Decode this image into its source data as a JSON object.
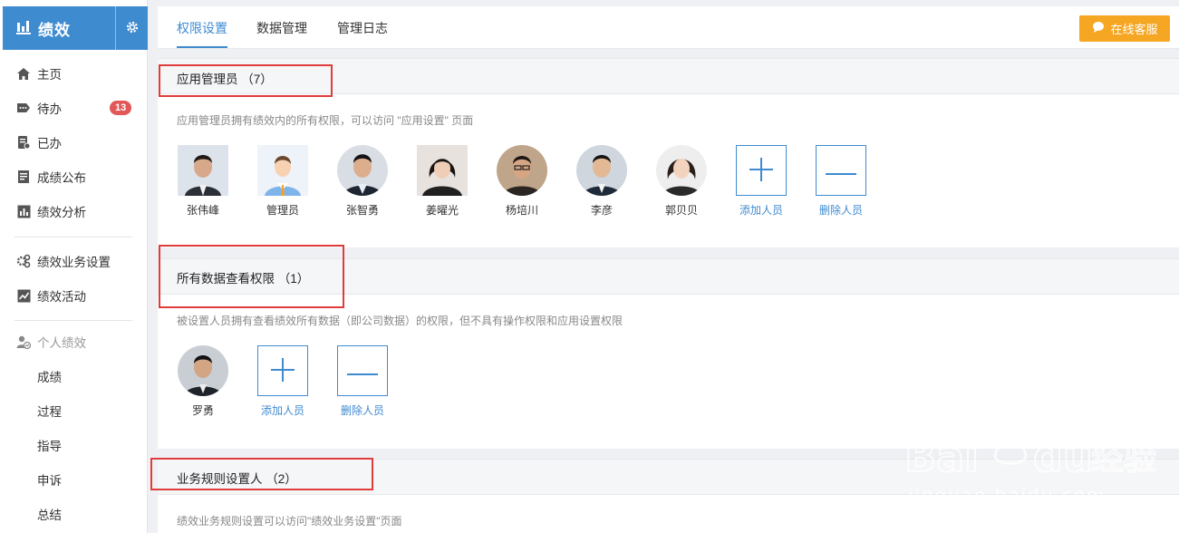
{
  "brand": {
    "title": "绩效",
    "icon": "bar-chart-icon",
    "settings_icon": "gear-icon",
    "color": "#3f8bd0"
  },
  "nav": {
    "home": "主页",
    "todo": "待办",
    "todo_badge": "13",
    "done": "已办",
    "results_publish": "成绩公布",
    "analysis": "绩效分析",
    "business_settings": "绩效业务设置",
    "activities": "绩效活动",
    "personal": "个人绩效",
    "sub": [
      "成绩",
      "过程",
      "指导",
      "申诉",
      "总结"
    ]
  },
  "tabs": [
    "权限设置",
    "数据管理",
    "管理日志"
  ],
  "support_button": "在线客服",
  "sections": {
    "admins": {
      "title": "应用管理员 （7）",
      "desc": "应用管理员拥有绩效内的所有权限，可以访问 \"应用设置\" 页面",
      "members": [
        "张伟峰",
        "管理员",
        "张智勇",
        "姜曜光",
        "杨培川",
        "李彦",
        "郭贝贝"
      ]
    },
    "data_view": {
      "title": "所有数据查看权限 （1）",
      "desc": "被设置人员拥有查看绩效所有数据（即公司数据）的权限，但不具有操作权限和应用设置权限",
      "members": [
        "罗勇"
      ]
    },
    "rules": {
      "title": "业务规则设置人 （2）",
      "desc": "绩效业务规则设置可以访问\"绩效业务设置\"页面"
    }
  },
  "actions": {
    "add": "添加人员",
    "remove": "删除人员"
  },
  "watermark": {
    "logo": "Baidu经验",
    "url": "jingyan.baidu.com"
  },
  "colors": {
    "accent": "#3f8bd0",
    "badge": "#e25757",
    "support": "#f5a623",
    "highlight": "#e03c3c"
  }
}
